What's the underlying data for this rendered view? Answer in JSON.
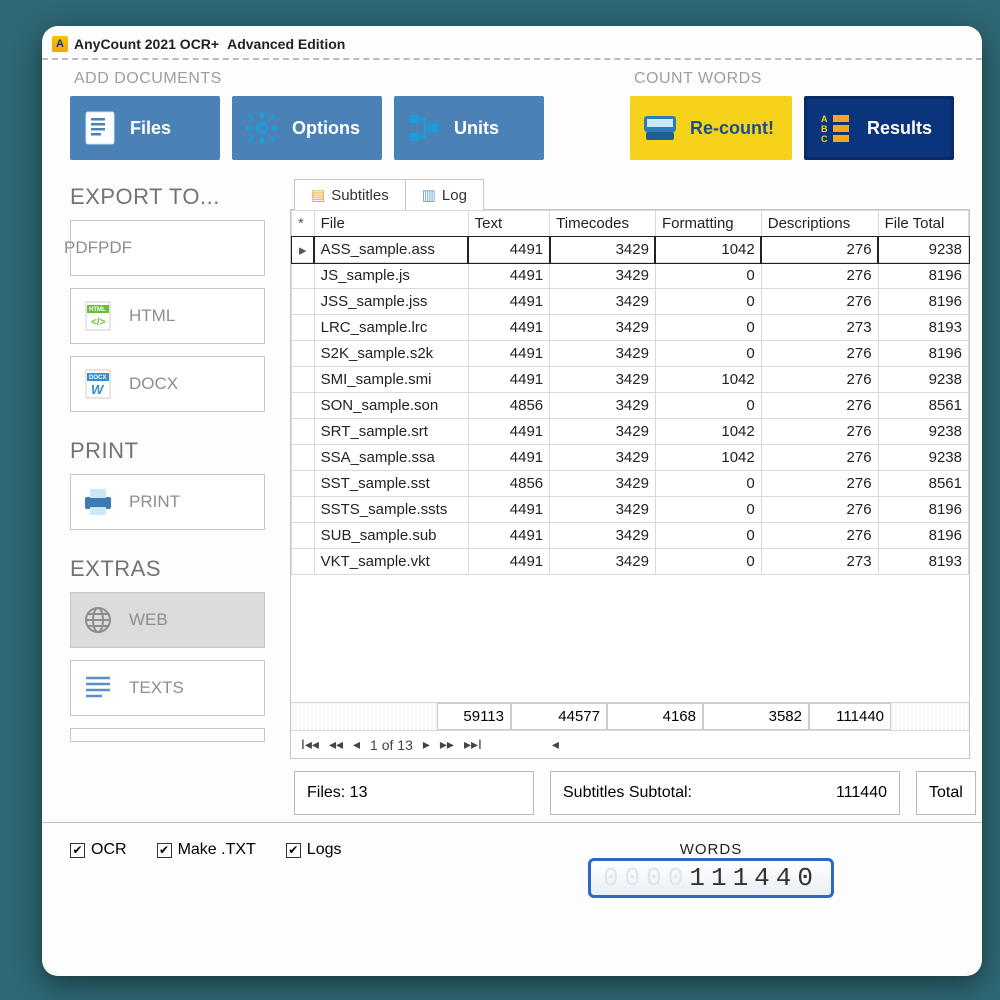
{
  "title": {
    "app_name": "AnyCount 2021 OCR+",
    "edition": "Advanced Edition"
  },
  "ribbon": {
    "group_add": "ADD DOCUMENTS",
    "group_count": "COUNT WORDS",
    "files": "Files",
    "options": "Options",
    "units": "Units",
    "recount": "Re-count!",
    "results": "Results"
  },
  "sidebar": {
    "export_h": "EXPORT TO...",
    "pdf": "PDF",
    "html": "HTML",
    "docx": "DOCX",
    "print_h": "PRINT",
    "print": "PRINT",
    "extras_h": "EXTRAS",
    "web": "WEB",
    "texts": "TEXTS"
  },
  "tabs": {
    "subtitles": "Subtitles",
    "log": "Log"
  },
  "columns": {
    "file": "File",
    "text": "Text",
    "timecodes": "Timecodes",
    "formatting": "Formatting",
    "descriptions": "Descriptions",
    "file_total": "File Total"
  },
  "rows": [
    {
      "file": "ASS_sample.ass",
      "text": 4491,
      "timecodes": 3429,
      "formatting": 1042,
      "descriptions": 276,
      "total": 9238
    },
    {
      "file": "JS_sample.js",
      "text": 4491,
      "timecodes": 3429,
      "formatting": 0,
      "descriptions": 276,
      "total": 8196
    },
    {
      "file": "JSS_sample.jss",
      "text": 4491,
      "timecodes": 3429,
      "formatting": 0,
      "descriptions": 276,
      "total": 8196
    },
    {
      "file": "LRC_sample.lrc",
      "text": 4491,
      "timecodes": 3429,
      "formatting": 0,
      "descriptions": 273,
      "total": 8193
    },
    {
      "file": "S2K_sample.s2k",
      "text": 4491,
      "timecodes": 3429,
      "formatting": 0,
      "descriptions": 276,
      "total": 8196
    },
    {
      "file": "SMI_sample.smi",
      "text": 4491,
      "timecodes": 3429,
      "formatting": 1042,
      "descriptions": 276,
      "total": 9238
    },
    {
      "file": "SON_sample.son",
      "text": 4856,
      "timecodes": 3429,
      "formatting": 0,
      "descriptions": 276,
      "total": 8561
    },
    {
      "file": "SRT_sample.srt",
      "text": 4491,
      "timecodes": 3429,
      "formatting": 1042,
      "descriptions": 276,
      "total": 9238
    },
    {
      "file": "SSA_sample.ssa",
      "text": 4491,
      "timecodes": 3429,
      "formatting": 1042,
      "descriptions": 276,
      "total": 9238
    },
    {
      "file": "SST_sample.sst",
      "text": 4856,
      "timecodes": 3429,
      "formatting": 0,
      "descriptions": 276,
      "total": 8561
    },
    {
      "file": "SSTS_sample.ssts",
      "text": 4491,
      "timecodes": 3429,
      "formatting": 0,
      "descriptions": 276,
      "total": 8196
    },
    {
      "file": "SUB_sample.sub",
      "text": 4491,
      "timecodes": 3429,
      "formatting": 0,
      "descriptions": 276,
      "total": 8196
    },
    {
      "file": "VKT_sample.vkt",
      "text": 4491,
      "timecodes": 3429,
      "formatting": 0,
      "descriptions": 273,
      "total": 8193
    }
  ],
  "totals": {
    "text": 59113,
    "timecodes": 44577,
    "formatting": 4168,
    "descriptions": 3582,
    "total": 111440
  },
  "pager": {
    "label": "1 of 13"
  },
  "status": {
    "files_label": "Files: 13",
    "subtotal_label": "Subtitles Subtotal:",
    "subtotal_value": "111440",
    "total_label": "Total"
  },
  "footer": {
    "ocr": "OCR",
    "make_txt": "Make .TXT",
    "logs": "Logs",
    "words_label": "WORDS",
    "words_value": "111440"
  }
}
